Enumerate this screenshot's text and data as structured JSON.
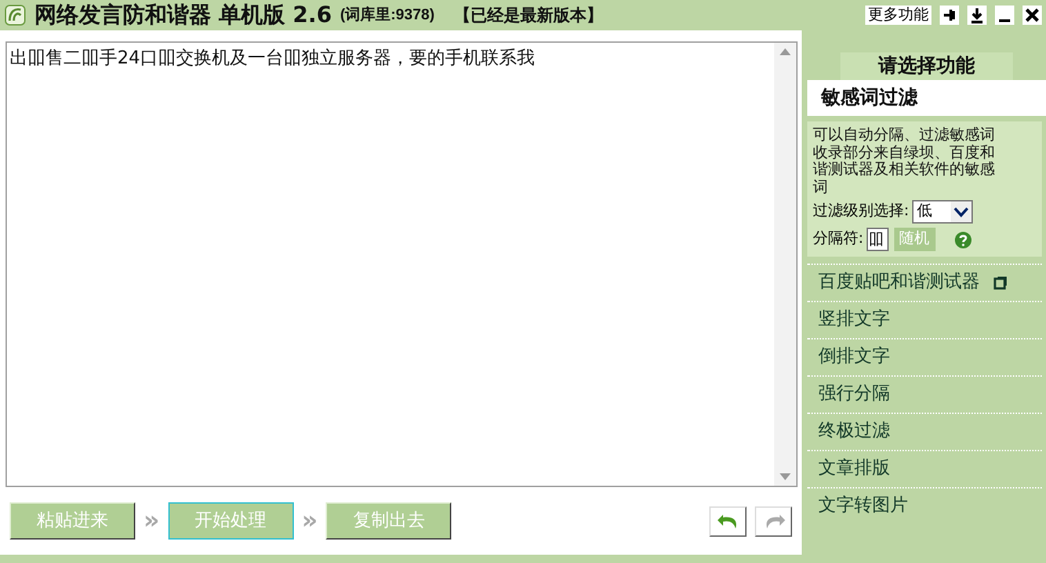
{
  "title_bar": {
    "app_name": "网络发言防和谐器 单机版 2.6",
    "word_count": "(词库里:9378)",
    "update_status": "【已经是最新版本】",
    "more_button": "更多功能"
  },
  "editor": {
    "value": "出吅售二吅手24口吅交换机及一台吅独立服务器，要的手机联系我"
  },
  "actions": [
    {
      "label": "粘贴进来",
      "selected": false
    },
    {
      "label": "开始处理",
      "selected": true
    },
    {
      "label": "复制出去",
      "selected": false
    }
  ],
  "separator_glyph": "»",
  "sidebar": {
    "heading": "请选择功能",
    "active": {
      "title": "敏感词过滤",
      "description": "可以自动分隔、过滤敏感词收录部分来自绿坝、百度和谐测试器及相关软件的敏感词",
      "level_label": "过滤级别选择:",
      "level_value": "低",
      "sep_label": "分隔符:",
      "sep_value": "吅",
      "random_button": "随机"
    },
    "items": [
      {
        "label": "百度贴吧和谐测试器",
        "external": true
      },
      {
        "label": "竖排文字",
        "external": false
      },
      {
        "label": "倒排文字",
        "external": false
      },
      {
        "label": "强行分隔",
        "external": false
      },
      {
        "label": "终极过滤",
        "external": false
      },
      {
        "label": "文章排版",
        "external": false
      },
      {
        "label": "文字转图片",
        "external": false
      }
    ]
  }
}
